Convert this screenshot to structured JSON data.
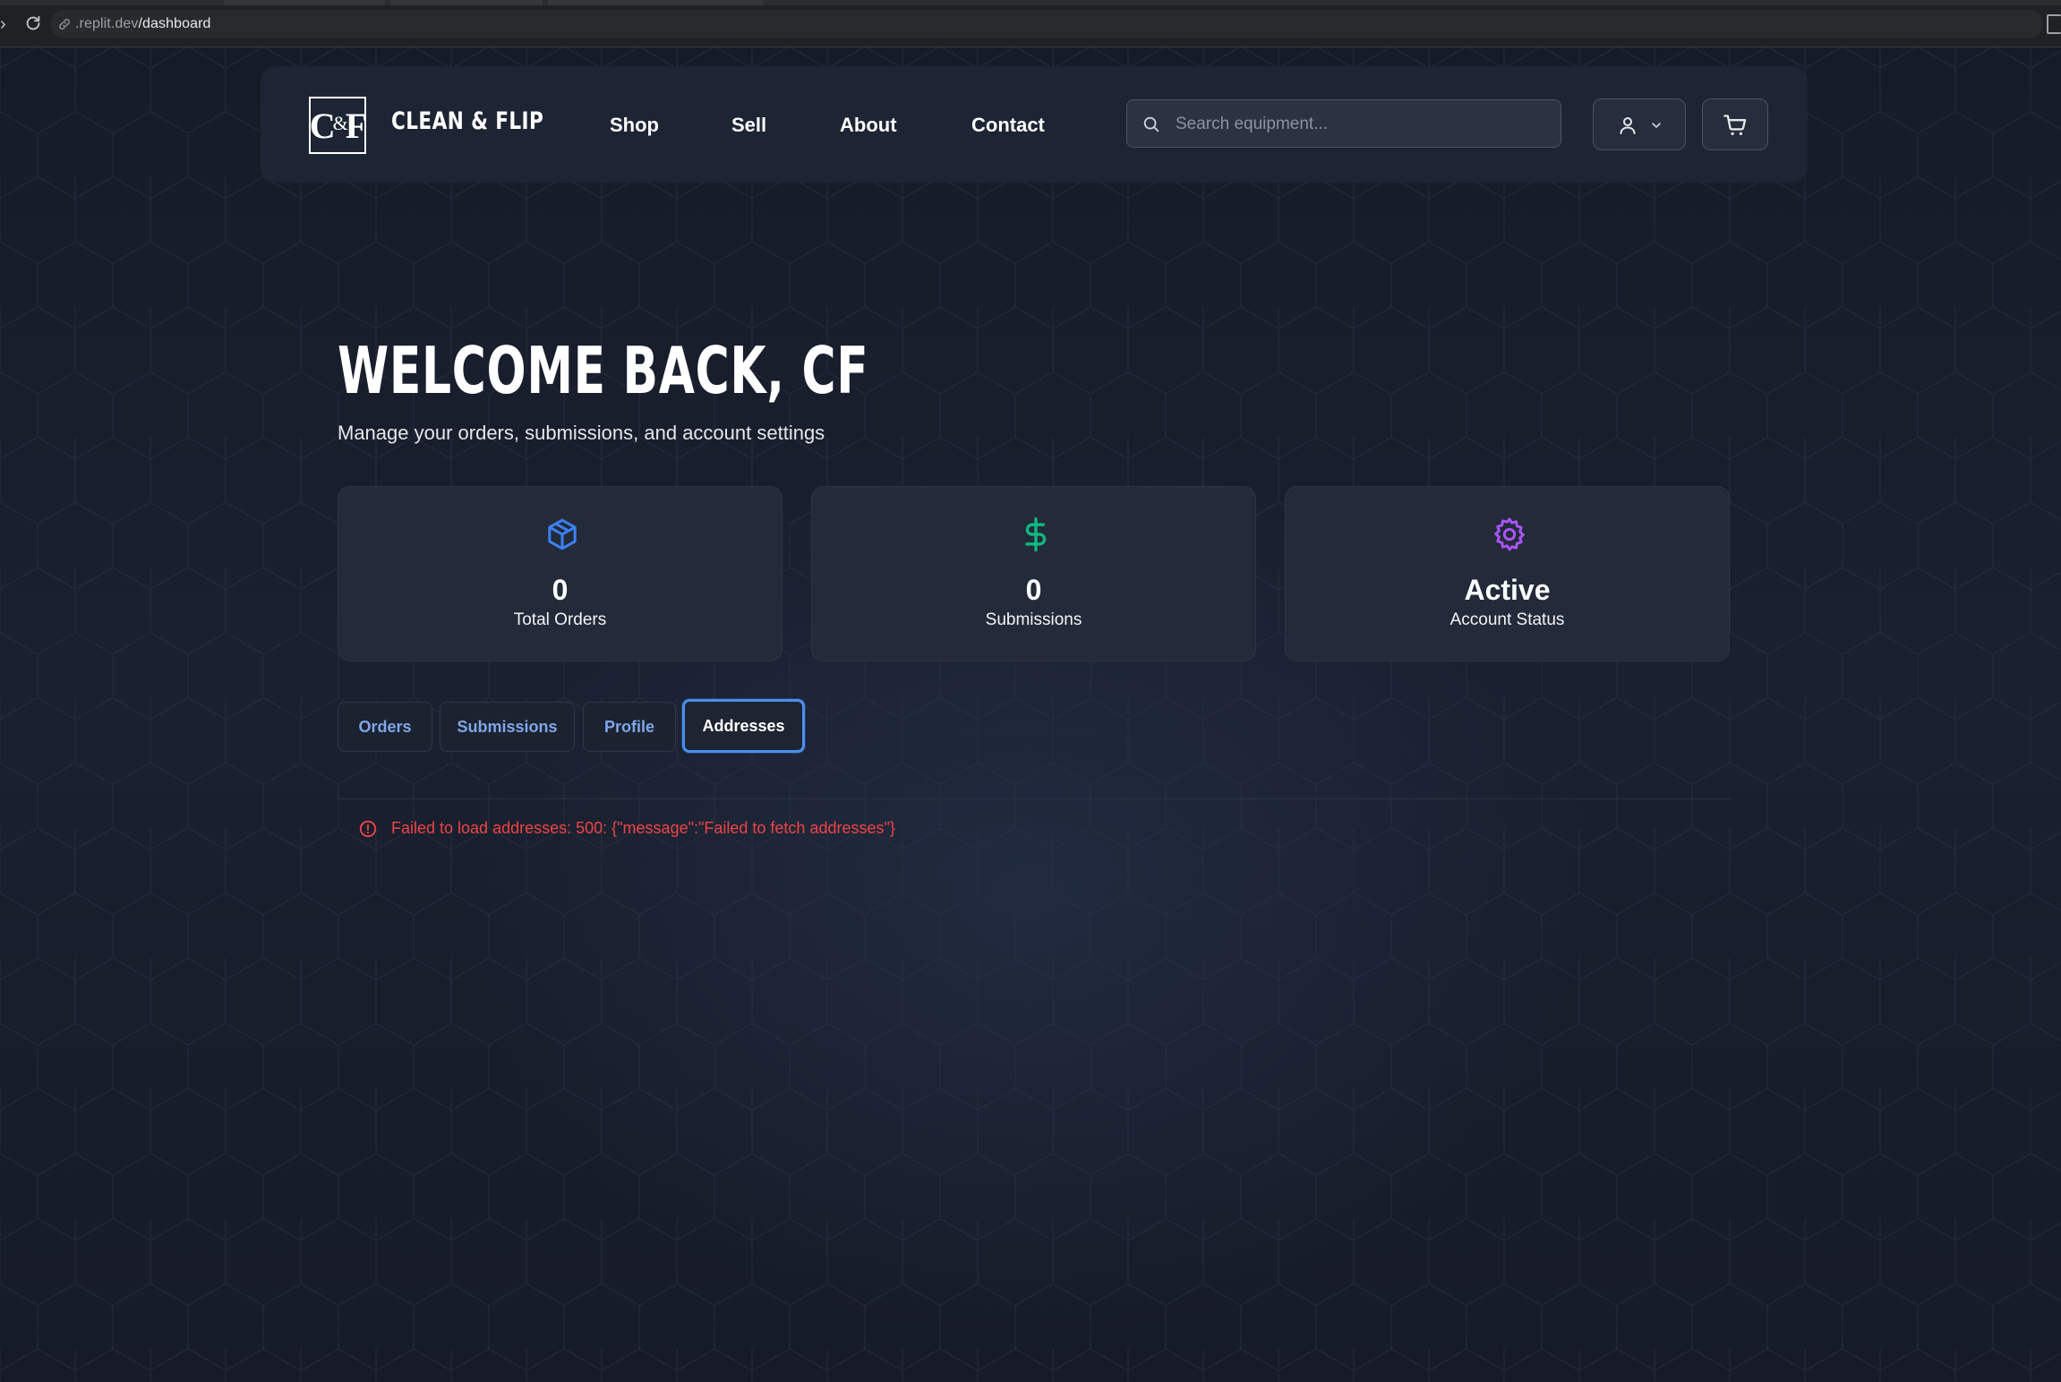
{
  "browser": {
    "url_prefix": ".replit.dev",
    "url_path": "/dashboard"
  },
  "brand": {
    "logo_left": "C",
    "logo_amp": "&",
    "logo_right": "F",
    "name": "CLEAN & FLIP"
  },
  "nav": {
    "links": [
      "Shop",
      "Sell",
      "About",
      "Contact"
    ]
  },
  "search": {
    "placeholder": "Search equipment..."
  },
  "hero": {
    "title": "WELCOME BACK, CF",
    "subtitle": "Manage your orders, submissions, and account settings"
  },
  "stats": [
    {
      "value": "0",
      "label": "Total Orders",
      "icon": "package-icon",
      "color": "#3b82f6"
    },
    {
      "value": "0",
      "label": "Submissions",
      "icon": "dollar-icon",
      "color": "#10b981"
    },
    {
      "value": "Active",
      "label": "Account Status",
      "icon": "gear-icon",
      "color": "#a855f7"
    }
  ],
  "tabs": [
    {
      "label": "Orders",
      "active": false
    },
    {
      "label": "Submissions",
      "active": false
    },
    {
      "label": "Profile",
      "active": false
    },
    {
      "label": "Addresses",
      "active": true
    }
  ],
  "error": {
    "message": "Failed to load addresses: 500: {\"message\":\"Failed to fetch addresses\"}",
    "color": "#ef4444"
  }
}
